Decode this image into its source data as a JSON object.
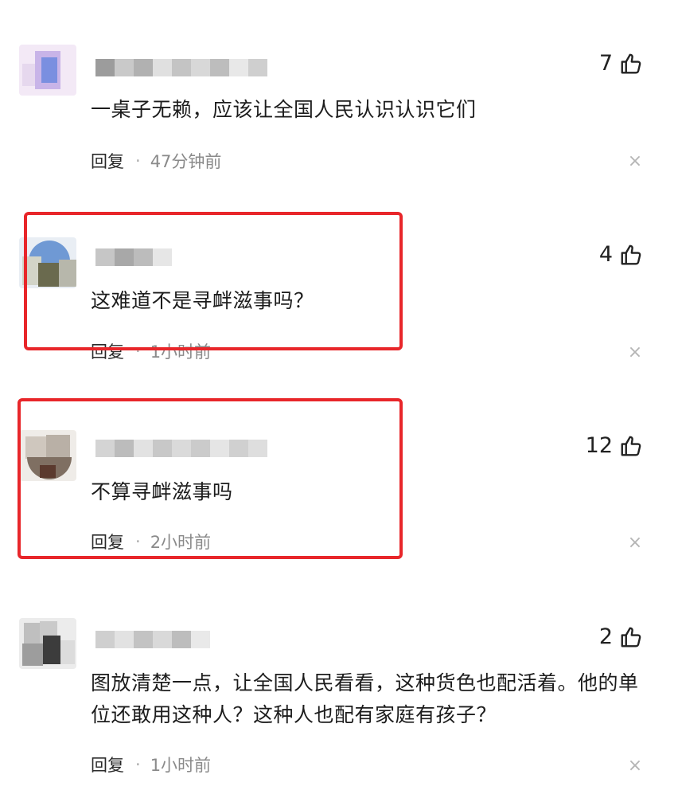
{
  "comments": [
    {
      "likes": "7",
      "text": "一桌子无赖，应该让全国人民认识认识它们",
      "reply_label": "回复",
      "separator": "·",
      "time": "47分钟前",
      "close": "×"
    },
    {
      "likes": "4",
      "text": "这难道不是寻衅滋事吗？",
      "reply_label": "回复",
      "separator": "·",
      "time": "1小时前",
      "close": "×"
    },
    {
      "likes": "12",
      "text": "不算寻衅滋事吗",
      "reply_label": "回复",
      "separator": "·",
      "time": "2小时前",
      "close": "×"
    },
    {
      "likes": "2",
      "text": "图放清楚一点，让全国人民看看，这种货色也配活着。他的单位还敢用这种人？这种人也配有家庭有孩子？",
      "reply_label": "回复",
      "separator": "·",
      "time": "1小时前",
      "close": "×"
    }
  ],
  "icons": {
    "like": "thumbs-up-icon",
    "close": "close-icon"
  },
  "colors": {
    "highlight": "#e8262a",
    "meta_time": "#8a8a8a"
  }
}
